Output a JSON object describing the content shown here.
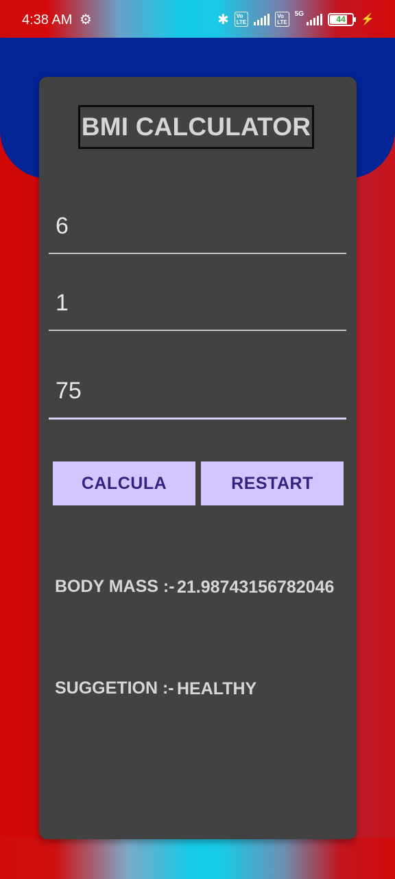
{
  "status_bar": {
    "time": "4:38 AM",
    "icons": [
      "settings-gear-icon",
      "bluetooth-icon",
      "volte-icon",
      "signal-icon",
      "5g-signal-icon",
      "battery-icon",
      "charging-icon"
    ],
    "volte_label": "Vo LTE",
    "network_label": "5G",
    "battery_level": "44"
  },
  "app": {
    "title": "BMI CALCULATOR",
    "fields": {
      "feet": "6",
      "inches": "1",
      "weight": "75"
    },
    "buttons": {
      "calculate": "CALCULA",
      "restart": "RESTART"
    },
    "results": {
      "body_mass_label": "BODY MASS :-",
      "body_mass_value": "21.98743156782046",
      "suggestion_label": "SUGGETION :-",
      "suggestion_value": "HEALTHY"
    }
  },
  "colors": {
    "background_red": "#d20808",
    "header_blue": "#032596",
    "card_gray": "#424242",
    "button_lavender": "#d3c6fe",
    "button_text_purple": "#38217f"
  }
}
